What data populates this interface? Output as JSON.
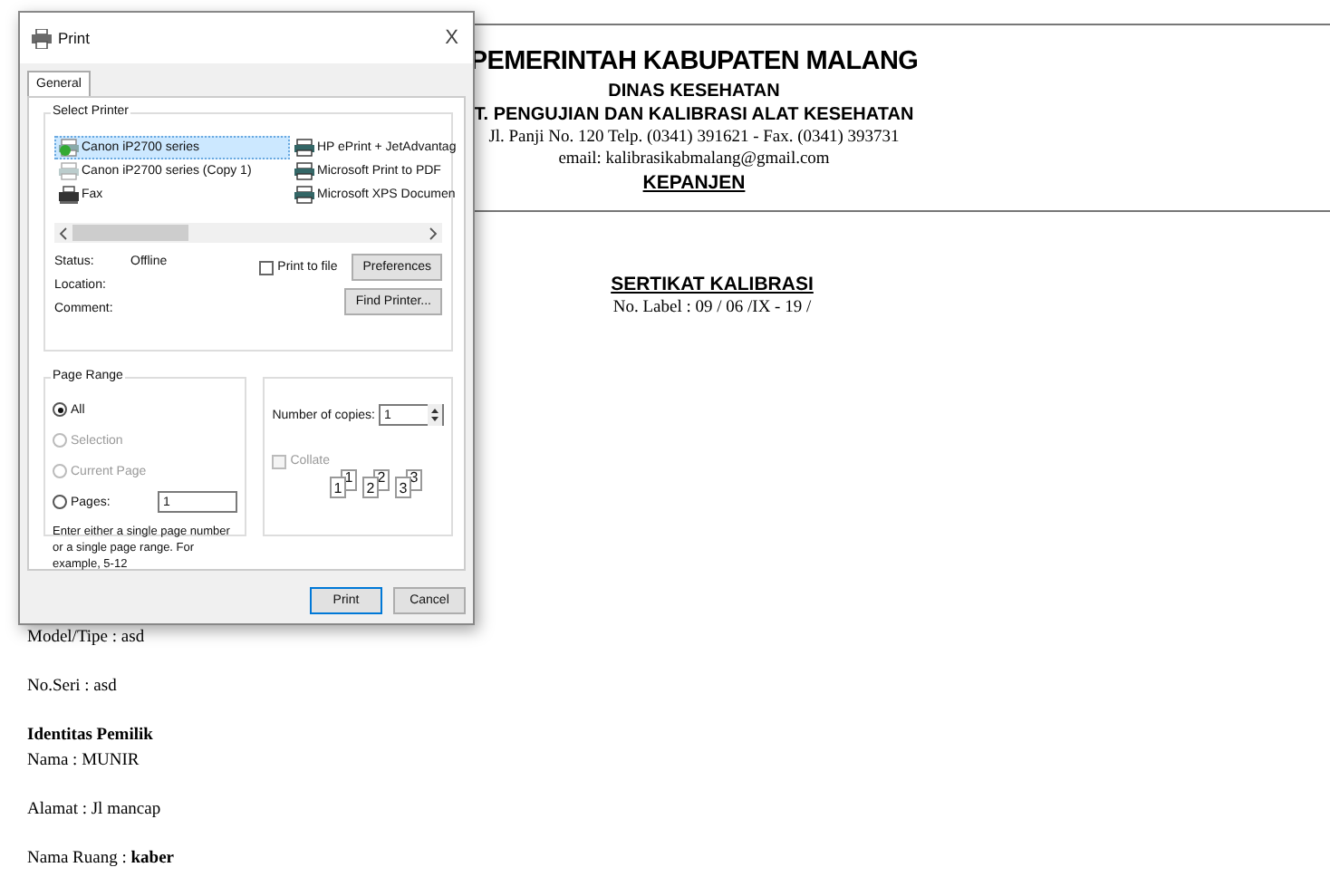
{
  "document": {
    "header": [
      {
        "text": "PEMERINTAH KABUPATEN MALANG",
        "kind": "title"
      },
      {
        "text": "DINAS KESEHATAN",
        "kind": "subtitle"
      },
      {
        "text": "T. PENGUJIAN DAN KALIBRASI ALAT KESEHATAN",
        "kind": "subtitle"
      },
      {
        "text": "Jl. Panji No. 120 Telp. (0341) 391621 - Fax. (0341) 393731",
        "kind": "address"
      },
      {
        "text": "email: kalibrasikabmalang@gmail.com",
        "kind": "address"
      },
      {
        "text": "KEPANJEN",
        "kind": "underlined"
      }
    ],
    "certificate": {
      "title": "SERTIKAT KALIBRASI",
      "label": "No. Label : 09 / 06 /IX - 19 /"
    },
    "fields": [
      {
        "text": "Model/Tipe : asd",
        "kind": "line"
      },
      {
        "text": "No.Seri : asd",
        "kind": "line"
      },
      {
        "text": "Identitas Pemilik",
        "kind": "heading"
      },
      {
        "text": "Nama : MUNIR",
        "kind": "sub"
      },
      {
        "text": "Alamat : Jl mancap",
        "kind": "line"
      },
      {
        "text": "Nama Ruang : **kaber**",
        "kind": "line"
      }
    ]
  },
  "dialog": {
    "title": "Print",
    "close": "X",
    "tabs": [
      {
        "label": "General",
        "selected": true
      }
    ],
    "select_printer": {
      "label": "Select Printer",
      "printers": [
        {
          "name": "Canon iP2700 series",
          "selected": true,
          "kind": "default"
        },
        {
          "name": "Canon iP2700 series (Copy 1)",
          "selected": false,
          "kind": "offline"
        },
        {
          "name": "Fax",
          "selected": false,
          "kind": "fax"
        },
        {
          "name": "HP ePrint + JetAdvantag",
          "selected": false,
          "kind": "printer"
        },
        {
          "name": "Microsoft Print to PDF",
          "selected": false,
          "kind": "printer"
        },
        {
          "name": "Microsoft XPS Documen",
          "selected": false,
          "kind": "printer"
        }
      ],
      "status_label": "Status:",
      "status": "Offline",
      "location_label": "Location:",
      "comment_label": "Comment:",
      "print_to_file": {
        "label": "Print to file",
        "checked": false
      },
      "preferences": "Preferences",
      "find_printer": "Find Printer..."
    },
    "page_range": {
      "label": "Page Range",
      "options": [
        {
          "label": "All",
          "selected": true,
          "disabled": false
        },
        {
          "label": "Selection",
          "selected": false,
          "disabled": true
        },
        {
          "label": "Current Page",
          "selected": false,
          "disabled": true
        },
        {
          "label": "Pages:",
          "selected": false,
          "disabled": false
        }
      ],
      "pages_value": "1",
      "hint": "Enter either a single page number or a single page range.  For example, 5-12"
    },
    "copies": {
      "label": "Number of copies:",
      "value": "1",
      "collate": {
        "label": "Collate",
        "checked": false,
        "disabled": true
      },
      "pages": [
        {
          "front": "1",
          "back": "1"
        },
        {
          "front": "2",
          "back": "2"
        },
        {
          "front": "3",
          "back": "3"
        }
      ]
    },
    "buttons": [
      {
        "label": "Print",
        "kind": "default"
      },
      {
        "label": "Cancel",
        "kind": "normal"
      }
    ]
  }
}
